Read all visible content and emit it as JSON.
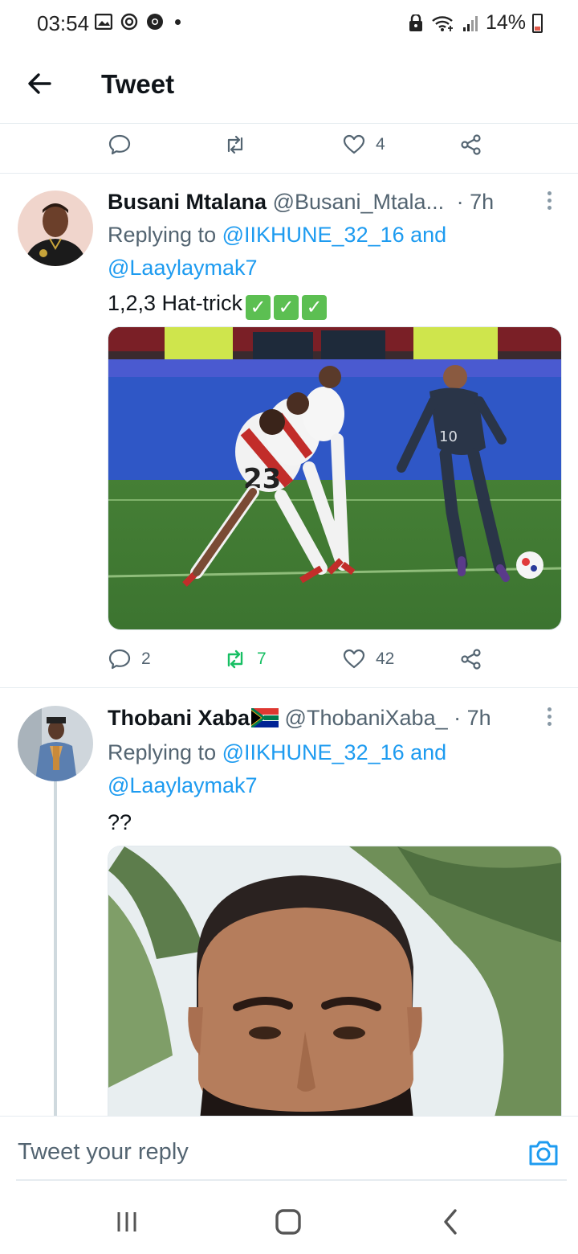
{
  "status_bar": {
    "time": "03:54",
    "battery": "14%",
    "icons": [
      "gallery-icon",
      "sync-icon",
      "chrome-icon",
      "dot",
      "lock-icon",
      "wifi-icon",
      "signal-icon",
      "battery-icon"
    ]
  },
  "header": {
    "title": "Tweet"
  },
  "top_actions": {
    "like_count": "4"
  },
  "tweets": [
    {
      "name": "Busani Mtalana",
      "handle": "@Busani_Mtala...",
      "time": "· 7h",
      "replying_prefix": "Replying to",
      "mention1": "@IIKHUNE_32_16 and",
      "mention2": "@Laaylaymak7",
      "text": "1,2,3 Hat-trick",
      "checks": [
        "✓",
        "✓",
        "✓"
      ],
      "reply_count": "2",
      "retweet_count": "7",
      "like_count": "42"
    },
    {
      "name": "Thobani Xaba",
      "handle": "@ThobaniXaba_",
      "time": "· 7h",
      "replying_prefix": "Replying to",
      "mention1": "@IIKHUNE_32_16 and",
      "mention2": "@Laaylaymak7",
      "text": "??"
    }
  ],
  "reply_bar": {
    "placeholder": "Tweet your reply"
  },
  "colors": {
    "link": "#1d9bf0",
    "retweet_active": "#17bf63",
    "secondary_text": "#536471"
  }
}
